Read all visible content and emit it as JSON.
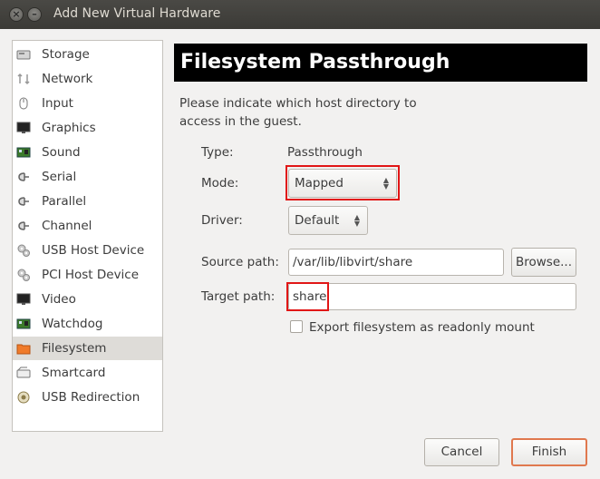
{
  "window": {
    "title": "Add New Virtual Hardware"
  },
  "sidebar": {
    "items": [
      {
        "label": "Storage",
        "icon": "storage-icon"
      },
      {
        "label": "Network",
        "icon": "network-icon"
      },
      {
        "label": "Input",
        "icon": "mouse-icon"
      },
      {
        "label": "Graphics",
        "icon": "monitor-icon"
      },
      {
        "label": "Sound",
        "icon": "sound-card-icon"
      },
      {
        "label": "Serial",
        "icon": "serial-plug-icon"
      },
      {
        "label": "Parallel",
        "icon": "parallel-plug-icon"
      },
      {
        "label": "Channel",
        "icon": "channel-plug-icon"
      },
      {
        "label": "USB Host Device",
        "icon": "usb-gear-icon"
      },
      {
        "label": "PCI Host Device",
        "icon": "pci-gear-icon"
      },
      {
        "label": "Video",
        "icon": "monitor-icon"
      },
      {
        "label": "Watchdog",
        "icon": "watchdog-icon"
      },
      {
        "label": "Filesystem",
        "icon": "folder-icon"
      },
      {
        "label": "Smartcard",
        "icon": "smartcard-icon"
      },
      {
        "label": "USB Redirection",
        "icon": "usb-redirection-icon"
      }
    ],
    "selected": "Filesystem"
  },
  "panel": {
    "header": "Filesystem Passthrough",
    "description": "Please indicate which host directory to access in the guest.",
    "type_label": "Type:",
    "type_value": "Passthrough",
    "mode_label": "Mode:",
    "mode_value": "Mapped",
    "driver_label": "Driver:",
    "driver_value": "Default",
    "source_label": "Source path:",
    "source_value": "/var/lib/libvirt/share",
    "browse_label": "Browse...",
    "target_label": "Target path:",
    "target_value": "share",
    "readonly_label": "Export filesystem as readonly mount"
  },
  "buttons": {
    "cancel": "Cancel",
    "finish": "Finish"
  },
  "colors": {
    "highlight": "#e11616",
    "header_bg": "#000000",
    "finish_border": "#e0784e"
  }
}
